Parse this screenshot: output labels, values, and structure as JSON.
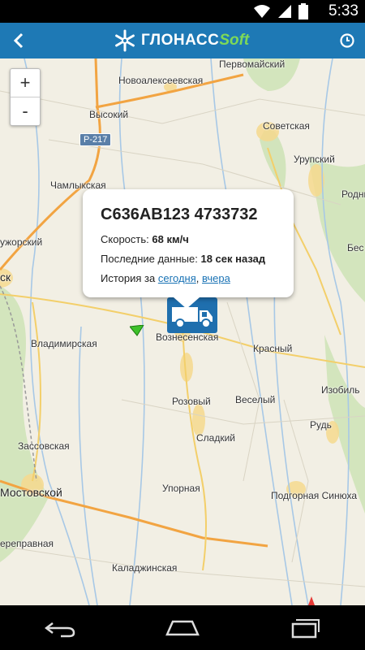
{
  "status_bar": {
    "time": "5:33",
    "icons": [
      "wifi-icon",
      "signal-icon",
      "battery-icon"
    ]
  },
  "app_bar": {
    "logo_part1": "ГЛОНАСС",
    "logo_part2": "Soft",
    "back_icon": "chevron-left-icon",
    "history_icon": "clock-icon"
  },
  "map": {
    "zoom_in_label": "+",
    "zoom_out_label": "-",
    "road_label": "Р-217",
    "places": {
      "pervomaiskiy": "Первомайский",
      "novoalekseevskaya": "Новоалексеевская",
      "vysokiy": "Высокий",
      "sovetskaya": "Советская",
      "urupskiy": "Урупский",
      "chamlykskaya": "Чамлыкская",
      "rodnik": "Родни",
      "luzhorskiy": "ужорский",
      "bes": "Бес",
      "sk": "ск",
      "voznesenskaya": "Вознесенская",
      "vladimirskaya": "Владимирская",
      "krasnyy": "Красный",
      "izobilnyy": "Изобиль",
      "rozovyy": "Розовый",
      "veselyy": "Веселый",
      "rud": "Рудь",
      "sladkiy": "Сладкий",
      "zassovskaya": "Зассовская",
      "mostovskoy": "Мостовской",
      "upornaya": "Упорная",
      "podgornaya_sinyukha": "Подгорная Синюха",
      "pereprovnaya": "ереправная",
      "kaladzhinskaya": "Каладжинская"
    }
  },
  "popup": {
    "title": "С636АВ123 4733732",
    "speed_label": "Скорость:",
    "speed_value": "68 км/ч",
    "last_data_label": "Последние данные:",
    "last_data_value": "18 сек назад",
    "history_label": "История за",
    "history_today": "сегодня",
    "history_sep": ",",
    "history_yesterday": "вчера"
  },
  "nav_bar": {
    "icons": [
      "back-nav-icon",
      "home-nav-icon",
      "recents-nav-icon"
    ]
  },
  "colors": {
    "app_bar": "#1e79b5",
    "logo_accent": "#7ed957",
    "link": "#1a73b5",
    "map_bg": "#f2efe4",
    "truck": "#1f6fae"
  }
}
